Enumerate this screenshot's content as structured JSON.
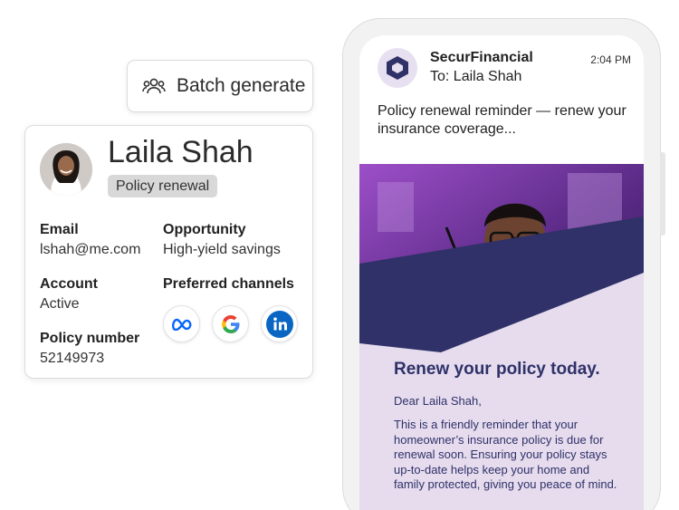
{
  "batch": {
    "label": "Batch generate",
    "icon": "users-icon"
  },
  "profile": {
    "name": "Laila Shah",
    "tag": "Policy renewal",
    "email_label": "Email",
    "email_value": "lshah@me.com",
    "opportunity_label": "Opportunity",
    "opportunity_value": "High-yield savings",
    "account_label": "Account",
    "account_value": "Active",
    "channels_label": "Preferred channels",
    "policy_label": "Policy number",
    "policy_value": "52149973",
    "channels": [
      "meta-icon",
      "google-icon",
      "linkedin-icon"
    ]
  },
  "email": {
    "sender": "SecurFinancial",
    "to": "To: Laila Shah",
    "time": "2:04 PM",
    "subject": "Policy renewal reminder — renew your insurance coverage...",
    "headline": "Renew your policy today.",
    "greeting": "Dear Laila Shah,",
    "body": "This is a friendly reminder that your homeowner’s insurance policy is due for renewal soon. Ensuring your policy stays up-to-date helps keep your home and family protected, giving you peace of mind."
  },
  "colors": {
    "brand_navy": "#2f3168",
    "lavender": "#e6dcee",
    "tag_gray": "#d8d8d8",
    "meta_blue": "#0866ff",
    "linkedin_blue": "#0a66c2"
  }
}
